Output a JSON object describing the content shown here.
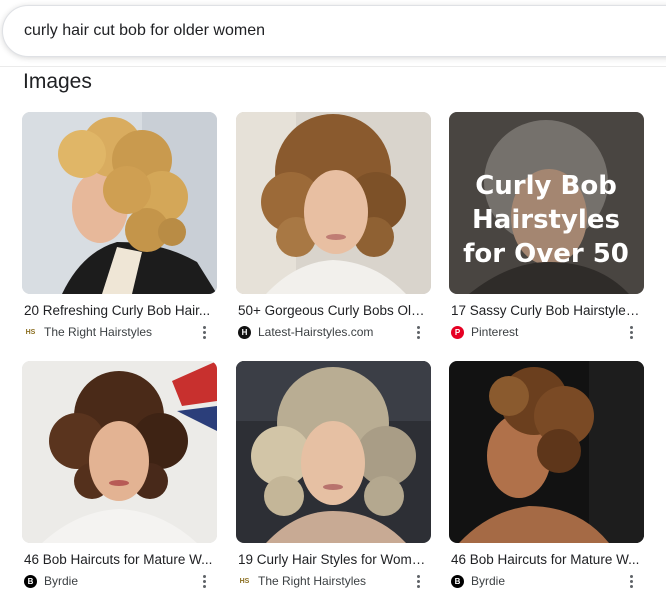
{
  "search": {
    "query": "curly hair cut bob for older women"
  },
  "section": {
    "title": "Images"
  },
  "results": [
    {
      "title": "20 Refreshing Curly Bob Hair...",
      "source": "The Right Hairstyles",
      "favicon": "HS"
    },
    {
      "title": "50+ Gorgeous Curly Bobs Old...",
      "source": "Latest-Hairstyles.com",
      "favicon": "H"
    },
    {
      "title": "17 Sassy Curly Bob Hairstyles ...",
      "source": "Pinterest",
      "favicon": "P"
    },
    {
      "title": "46 Bob Haircuts for Mature W...",
      "source": "Byrdie",
      "favicon": "B"
    },
    {
      "title": "19 Curly Hair Styles for Wome...",
      "source": "The Right Hairstyles",
      "favicon": "HS"
    },
    {
      "title": "46 Bob Haircuts for Mature W...",
      "source": "Byrdie",
      "favicon": "B"
    }
  ],
  "overlay": {
    "line1": "Curly Bob",
    "line2": "Hairstyles",
    "line3": "for Over 50"
  },
  "colors": {
    "pinterest": "#e60023",
    "text": "#202124",
    "secondary": "#3c4043"
  }
}
